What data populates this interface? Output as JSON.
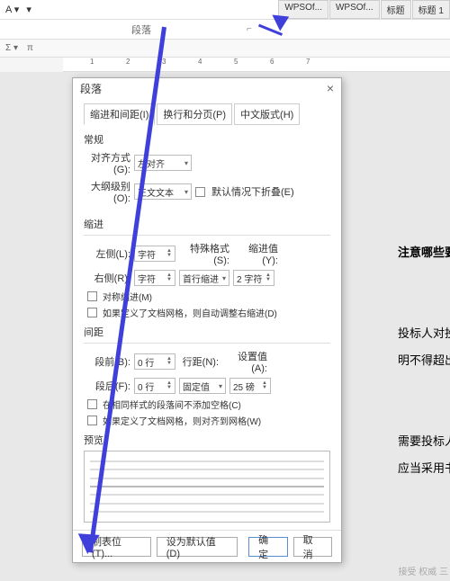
{
  "tabs": {
    "t1": "WPSOf...",
    "t2": "WPSOf...",
    "t3": "标题",
    "t4": "标题 1"
  },
  "ribbon": {
    "group": "段落",
    "launcher": "⌐",
    "fx_pi": "π"
  },
  "ruler": {
    "m1": "1",
    "m2": "2",
    "m3": "3",
    "m4": "4",
    "m5": "5",
    "m6": "6",
    "m7": "7"
  },
  "doc": {
    "l1": "注意哪些要点",
    "l2": "投标人对投标",
    "l3": "明不得超出投",
    "l4": "需要投标人作",
    "l5": "应当采用书面"
  },
  "dialog": {
    "title": "段落",
    "tabs": {
      "t1": "缩进和间距(I)",
      "t2": "换行和分页(P)",
      "t3": "中文版式(H)"
    },
    "general": {
      "header": "常规",
      "align_lbl": "对齐方式(G):",
      "align_val": "左对齐",
      "outline_lbl": "大纲级别(O):",
      "outline_val": "正文文本",
      "collapse": "默认情况下折叠(E)"
    },
    "indent": {
      "header": "缩进",
      "left_lbl": "左侧(L):",
      "left_val": "字符",
      "right_lbl": "右侧(R):",
      "right_val": "字符",
      "special_lbl": "特殊格式(S):",
      "special_val": "首行缩进",
      "by_lbl": "缩进值(Y):",
      "by_val": "2 字符",
      "mirror": "对称缩进(M)",
      "grid": "如果定义了文档网格，则自动调整右缩进(D)"
    },
    "spacing": {
      "header": "间距",
      "before_lbl": "段前(B):",
      "before_val": "0 行",
      "after_lbl": "段后(F):",
      "after_val": "0 行",
      "line_lbl": "行距(N):",
      "line_val": "固定值",
      "at_lbl": "设置值(A):",
      "at_val": "25 磅",
      "same": "在相同样式的段落间不添加空格(C)",
      "snap": "如果定义了文档网格，则对齐到网格(W)"
    },
    "preview_lbl": "预览",
    "buttons": {
      "tabs": "制表位(T)...",
      "default": "设为默认值(D)",
      "ok": "确定",
      "cancel": "取消"
    }
  },
  "wm": "接受 权威 三"
}
